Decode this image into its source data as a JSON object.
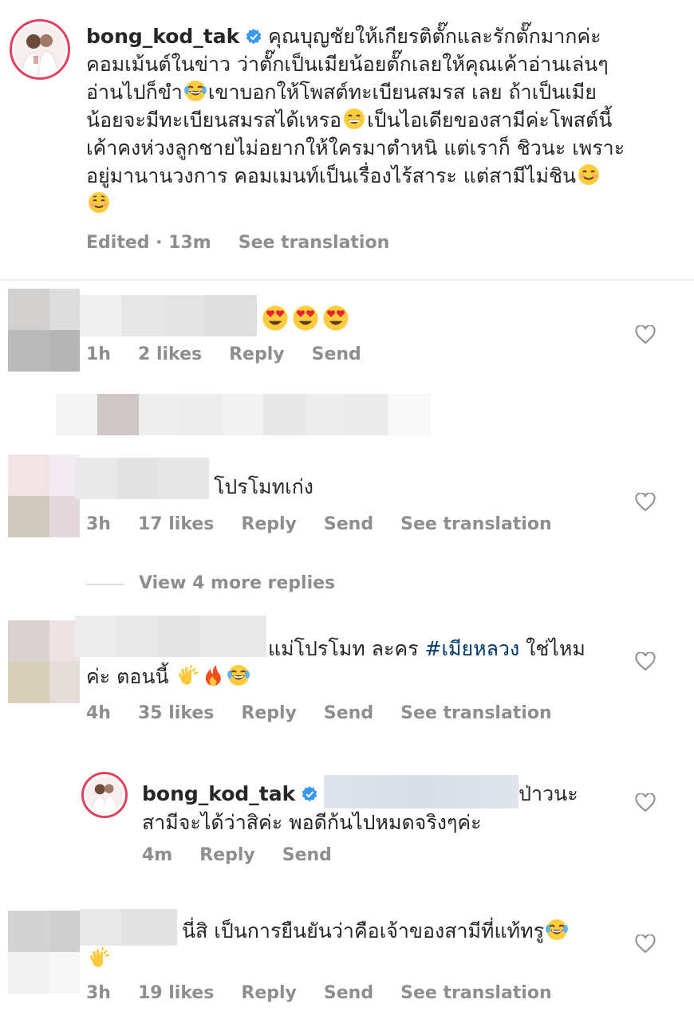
{
  "post_comment": {
    "username": "bong_kod_tak",
    "line1": "คุณบุญชัยให้เกียรติตั๊กและรักตั๊กมากค่ะ",
    "line2": "คอมเม้นต์ในข่าว ว่าตั๊กเป็นเมียน้อยตั๊กเลยให้คุณเค้าอ่านเล่นๆ",
    "line3": "อ่านไปก็ขำ",
    "line3b": "เขาบอกให้โพสต์ทะเบียนสมรส  เลย ถ้าเป็นเมีย",
    "line4": "น้อยจะมีทะเบียนสมรสได้เหรอ",
    "line4b": "เป็นไอเดียของสามีค่ะโพสต์นี้",
    "line5": "เค้าคงห่วงลูกชายไม่อยากให้ใครมาตำหนิ แต่เราก็ ชิวนะ เพราะ",
    "line6": "อยู่มานานวงการ คอมเมนท์เป็นเรื่องไร้สาระ แต่สามีไม่ชิน",
    "edited": "Edited · 13m",
    "see_translation": "See translation"
  },
  "comment1": {
    "time": "1h",
    "likes": "2 likes",
    "reply": "Reply",
    "send": "Send"
  },
  "comment2": {
    "text": "โปรโมทเก่ง",
    "time": "3h",
    "likes": "17 likes",
    "reply": "Reply",
    "send": "Send",
    "see_translation": "See translation"
  },
  "view_more": "View 4 more replies",
  "comment3": {
    "text1": "แม่โปรโมท ละคร ",
    "hashtag": "#เมียหลวง",
    "text1b": " ใช่ไหม",
    "text2": "ค่ะ ตอนนี้ ",
    "time": "4h",
    "likes": "35 likes",
    "reply": "Reply",
    "send": "Send",
    "see_translation": "See translation"
  },
  "reply1": {
    "username": "bong_kod_tak",
    "text1": "ป่าวนะ",
    "text2": "สามีจะได้ว่าสิค่ะ พอดีก้นไปหมดจริงๆค่ะ",
    "time": "4m",
    "reply": "Reply",
    "send": "Send"
  },
  "comment4": {
    "text": "นี่สิ เป็นการยืนยันว่าคือเจ้าของสามีที่แท้ทรู",
    "time": "3h",
    "likes": "19 likes",
    "reply": "Reply",
    "send": "Send",
    "see_translation": "See translation"
  },
  "icons": {
    "verified": "verified-badge-icon",
    "heart": "heart-outline-icon",
    "laugh": "face-with-tears-of-joy-emoji",
    "grin": "grinning-face-emoji",
    "smile": "smiling-face-emoji",
    "blush": "smiling-face-blush-emoji",
    "heart_eyes": "heart-eyes-emoji",
    "clap": "clapping-hands-emoji",
    "fire": "fire-emoji"
  },
  "colors": {
    "text": "#262626",
    "meta": "#8e8e8e",
    "verified": "#3897f0",
    "hashtag": "#00376b",
    "divider": "#efefef"
  }
}
